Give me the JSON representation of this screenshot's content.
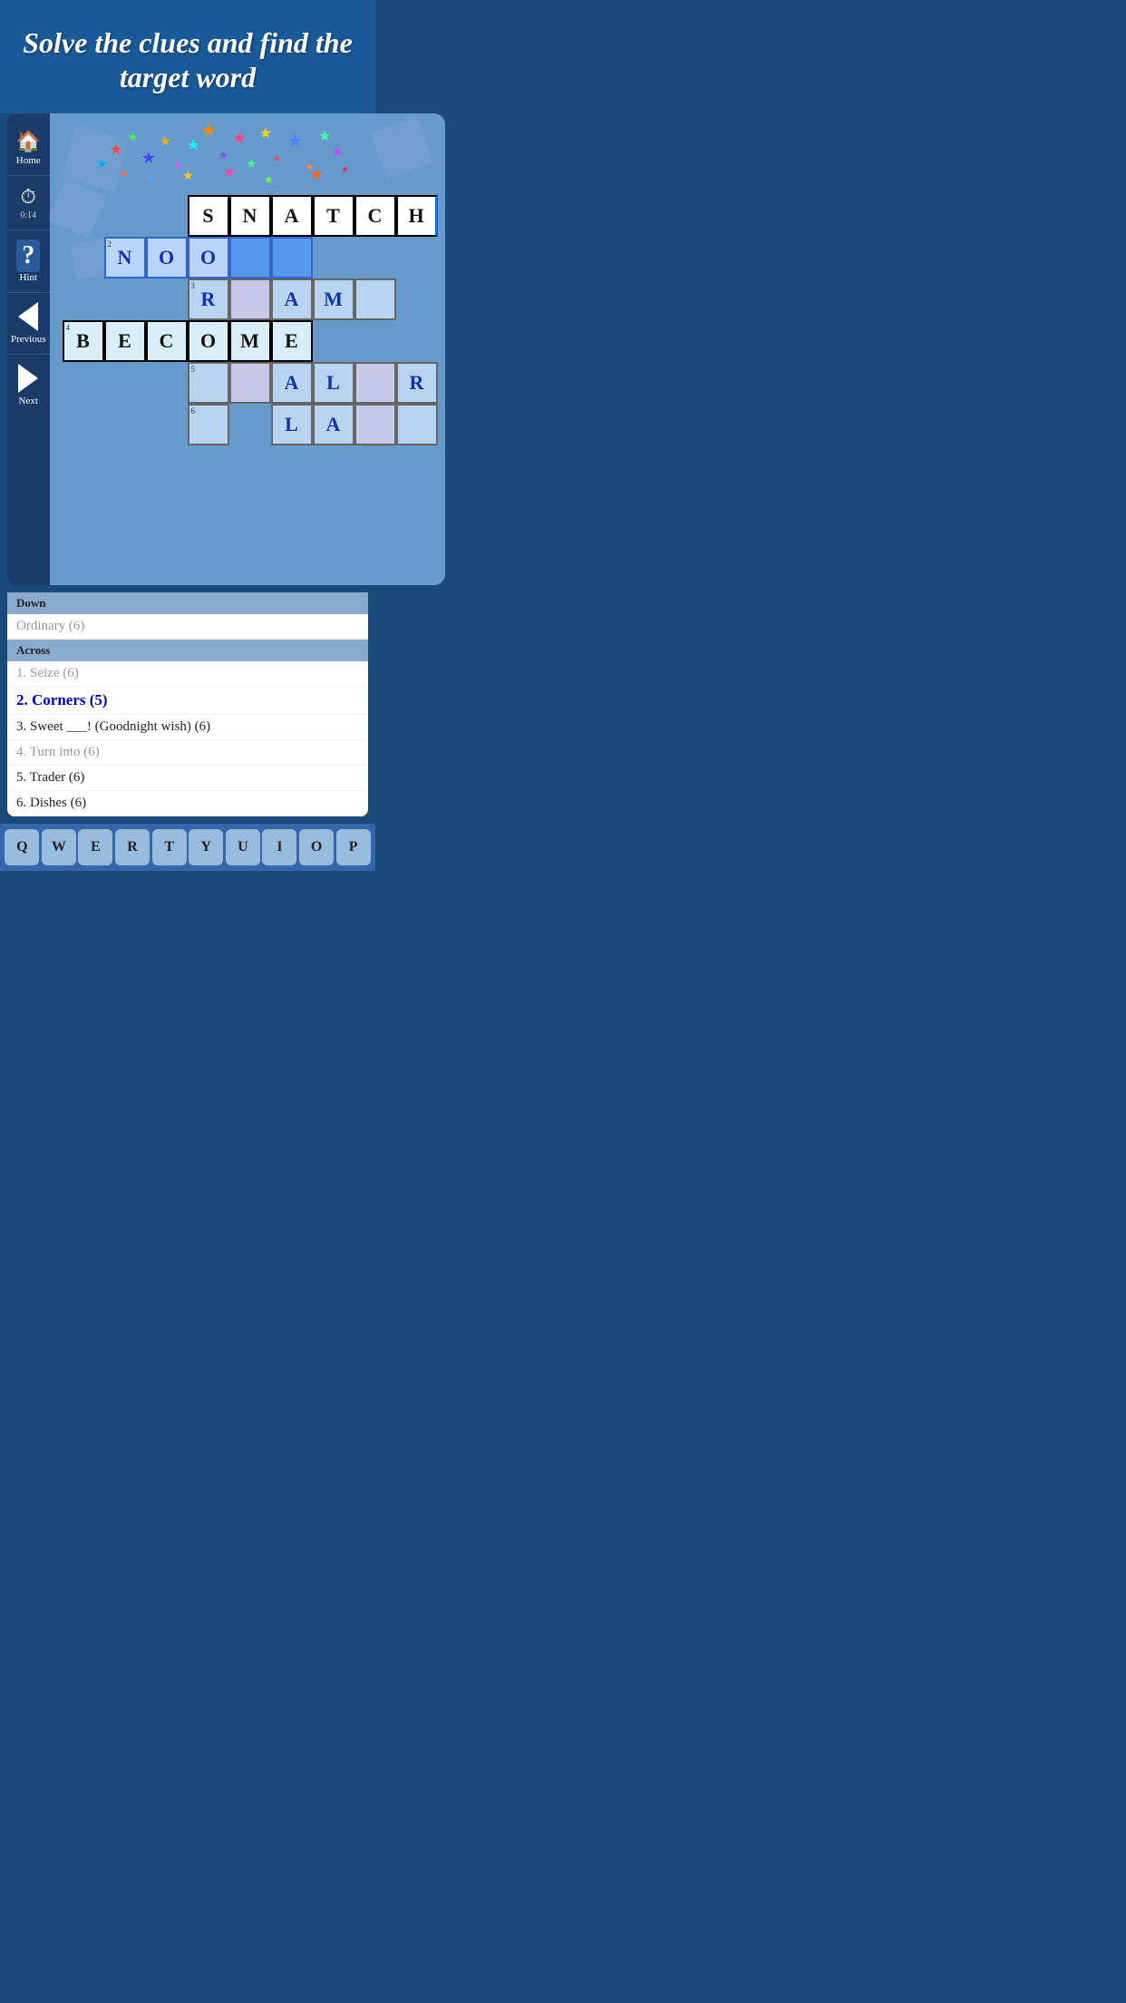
{
  "header": {
    "title": "Solve the clues and find the target word"
  },
  "sidebar": {
    "home_label": "Home",
    "timer_label": "0:14",
    "hint_label": "Hint",
    "previous_label": "Previous",
    "next_label": "Next"
  },
  "grid": {
    "rows": [
      [
        null,
        null,
        null,
        {
          "letter": "S",
          "clue_num": null,
          "style": "solved"
        },
        {
          "letter": "N",
          "clue_num": null,
          "style": "solved"
        },
        {
          "letter": "A",
          "clue_num": null,
          "style": "solved"
        },
        {
          "letter": "T",
          "clue_num": null,
          "style": "solved"
        },
        {
          "letter": "C",
          "clue_num": null,
          "style": "solved"
        },
        {
          "letter": "H",
          "clue_num": null,
          "style": "solved"
        }
      ],
      [
        null,
        {
          "letter": "N",
          "clue_num": "2",
          "style": "active"
        },
        {
          "letter": "O",
          "clue_num": null,
          "style": "active"
        },
        {
          "letter": "O",
          "clue_num": null,
          "style": "active"
        },
        {
          "letter": "",
          "clue_num": null,
          "style": "active-empty"
        },
        {
          "letter": "",
          "clue_num": null,
          "style": "active-empty"
        },
        null,
        null,
        null
      ],
      [
        null,
        null,
        null,
        {
          "letter": "R",
          "clue_num": "3",
          "style": "normal"
        },
        null,
        {
          "letter": "A",
          "clue_num": null,
          "style": "normal"
        },
        {
          "letter": "M",
          "clue_num": null,
          "style": "normal"
        },
        {
          "letter": "",
          "clue_num": null,
          "style": "normal"
        },
        null
      ],
      [
        {
          "letter": "B",
          "clue_num": "4",
          "style": "solved"
        },
        {
          "letter": "E",
          "clue_num": null,
          "style": "solved"
        },
        {
          "letter": "C",
          "clue_num": null,
          "style": "solved"
        },
        {
          "letter": "O",
          "clue_num": null,
          "style": "solved"
        },
        {
          "letter": "M",
          "clue_num": null,
          "style": "solved"
        },
        {
          "letter": "E",
          "clue_num": null,
          "style": "solved"
        },
        null,
        null,
        null
      ],
      [
        null,
        null,
        null,
        {
          "letter": "",
          "clue_num": "5",
          "style": "normal"
        },
        {
          "letter": "",
          "clue_num": null,
          "style": "normal"
        },
        {
          "letter": "A",
          "clue_num": null,
          "style": "normal"
        },
        {
          "letter": "L",
          "clue_num": null,
          "style": "normal"
        },
        {
          "letter": "",
          "clue_num": null,
          "style": "normal"
        },
        {
          "letter": "R",
          "clue_num": null,
          "style": "normal"
        }
      ],
      [
        null,
        null,
        null,
        {
          "letter": "",
          "clue_num": "6",
          "style": "normal"
        },
        null,
        {
          "letter": "L",
          "clue_num": null,
          "style": "normal"
        },
        {
          "letter": "A",
          "clue_num": null,
          "style": "normal"
        },
        {
          "letter": "",
          "clue_num": null,
          "style": "normal"
        },
        {
          "letter": "",
          "clue_num": null,
          "style": "normal"
        }
      ]
    ]
  },
  "clues": {
    "down_header": "Down",
    "down_items": [
      {
        "text": "Ordinary (6)",
        "style": "gray"
      }
    ],
    "across_header": "Across",
    "across_items": [
      {
        "num": "1",
        "text": "Seize (6)",
        "style": "gray"
      },
      {
        "num": "2",
        "text": "Corners (5)",
        "style": "active"
      },
      {
        "num": "3",
        "text": "Sweet ___! (Goodnight wish) (6)",
        "style": "normal"
      },
      {
        "num": "4",
        "text": "Turn into (6)",
        "style": "gray"
      },
      {
        "num": "5",
        "text": "Trader (6)",
        "style": "normal"
      },
      {
        "num": "6",
        "text": "Dishes (6)",
        "style": "normal"
      }
    ]
  },
  "keyboard": {
    "keys": [
      "Q",
      "W",
      "E",
      "R",
      "T",
      "Y",
      "U",
      "I",
      "O",
      "P"
    ]
  }
}
